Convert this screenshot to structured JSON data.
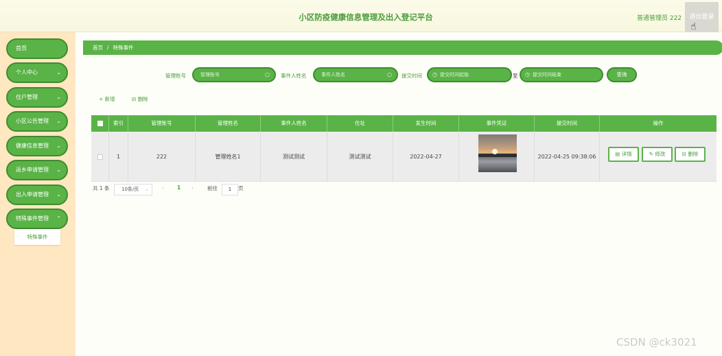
{
  "header": {
    "title": "小区防疫健康信息管理及出入登记平台",
    "user": "普通管理员 222",
    "logout": "退出登录"
  },
  "sidebar": {
    "items": [
      {
        "label": "首页"
      },
      {
        "label": "个人中心"
      },
      {
        "label": "住户管理"
      },
      {
        "label": "小区公告管理"
      },
      {
        "label": "健康信息管理"
      },
      {
        "label": "返乡申请管理"
      },
      {
        "label": "出入申请管理"
      },
      {
        "label": "特殊事件管理"
      }
    ],
    "submenu": "特殊事件"
  },
  "breadcrumb": {
    "home": "首页",
    "sep": "/",
    "current": "特殊事件"
  },
  "filters": {
    "account_label": "管理账号",
    "account_placeholder": "管理账号",
    "name_label": "事件人姓名",
    "name_placeholder": "事件人姓名",
    "time_label": "提交时间",
    "start_placeholder": "提交时间起始",
    "to": "至",
    "end_placeholder": "提交时间结束",
    "query": "查询"
  },
  "actions": {
    "add": "+ 新增",
    "delete": "删除"
  },
  "table": {
    "columns": [
      "索引",
      "管理账号",
      "管理姓名",
      "事件人姓名",
      "住址",
      "发生时间",
      "事件凭证",
      "提交时间",
      "操作"
    ],
    "rows": [
      {
        "index": "1",
        "account": "222",
        "manager_name": "管理姓名1",
        "person_name": "测试测试",
        "address": "测试测试",
        "occur_time": "2022-04-27",
        "submit_time": "2022-04-25 09:38:06"
      }
    ],
    "ops": {
      "detail": "详情",
      "edit": "修改",
      "delete": "删除"
    }
  },
  "pagination": {
    "total": "共 1 条",
    "page_size": "10条/页",
    "current_page": "1",
    "goto": "前往",
    "goto_value": "1",
    "page_unit": "页"
  },
  "watermark": "CSDN @ck3021",
  "colors": {
    "primary": "#5ab347",
    "sidebar_bg": "#ffe7c1",
    "header_bg": "#fbfbe9"
  }
}
